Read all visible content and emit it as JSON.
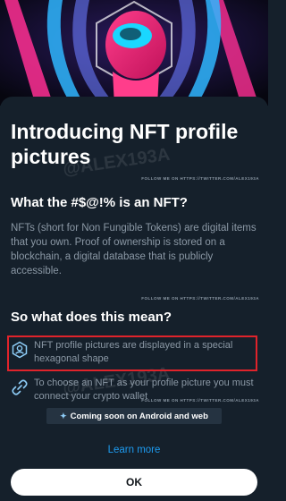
{
  "header": {
    "title": "Introducing NFT profile pictures",
    "follow_note": "FOLLOW ME ON HTTPS://TWITTER.COM/ALEX193A"
  },
  "section1": {
    "heading": "What the #$@!% is an NFT?",
    "body": "NFTs (short for Non Fungible Tokens) are digital items that you own. Proof of ownership is stored on a blockchain, a digital database that is publicly accessible.",
    "follow_note": "FOLLOW ME ON HTTPS://TWITTER.COM/ALEX193A"
  },
  "section2": {
    "heading": "So what does this mean?",
    "features": [
      {
        "icon": "hexagon-profile-icon",
        "text": "NFT profile pictures are displayed in a special hexagonal shape"
      },
      {
        "icon": "link-icon",
        "text": "To choose an NFT as your profile picture you must connect your crypto wallet"
      }
    ],
    "follow_note": "FOLLOW ME ON HTTPS://TWITTER.COM/ALEX193A"
  },
  "notice": {
    "icon": "sparkle-icon",
    "text": "Coming soon on Android and web"
  },
  "actions": {
    "learn_more": "Learn more",
    "ok": "OK"
  },
  "watermark": "@ALEX193A",
  "colors": {
    "background": "#15202b",
    "accent": "#1d9bf0",
    "highlight_border": "#e0232b",
    "muted_text": "#8b98a5"
  }
}
